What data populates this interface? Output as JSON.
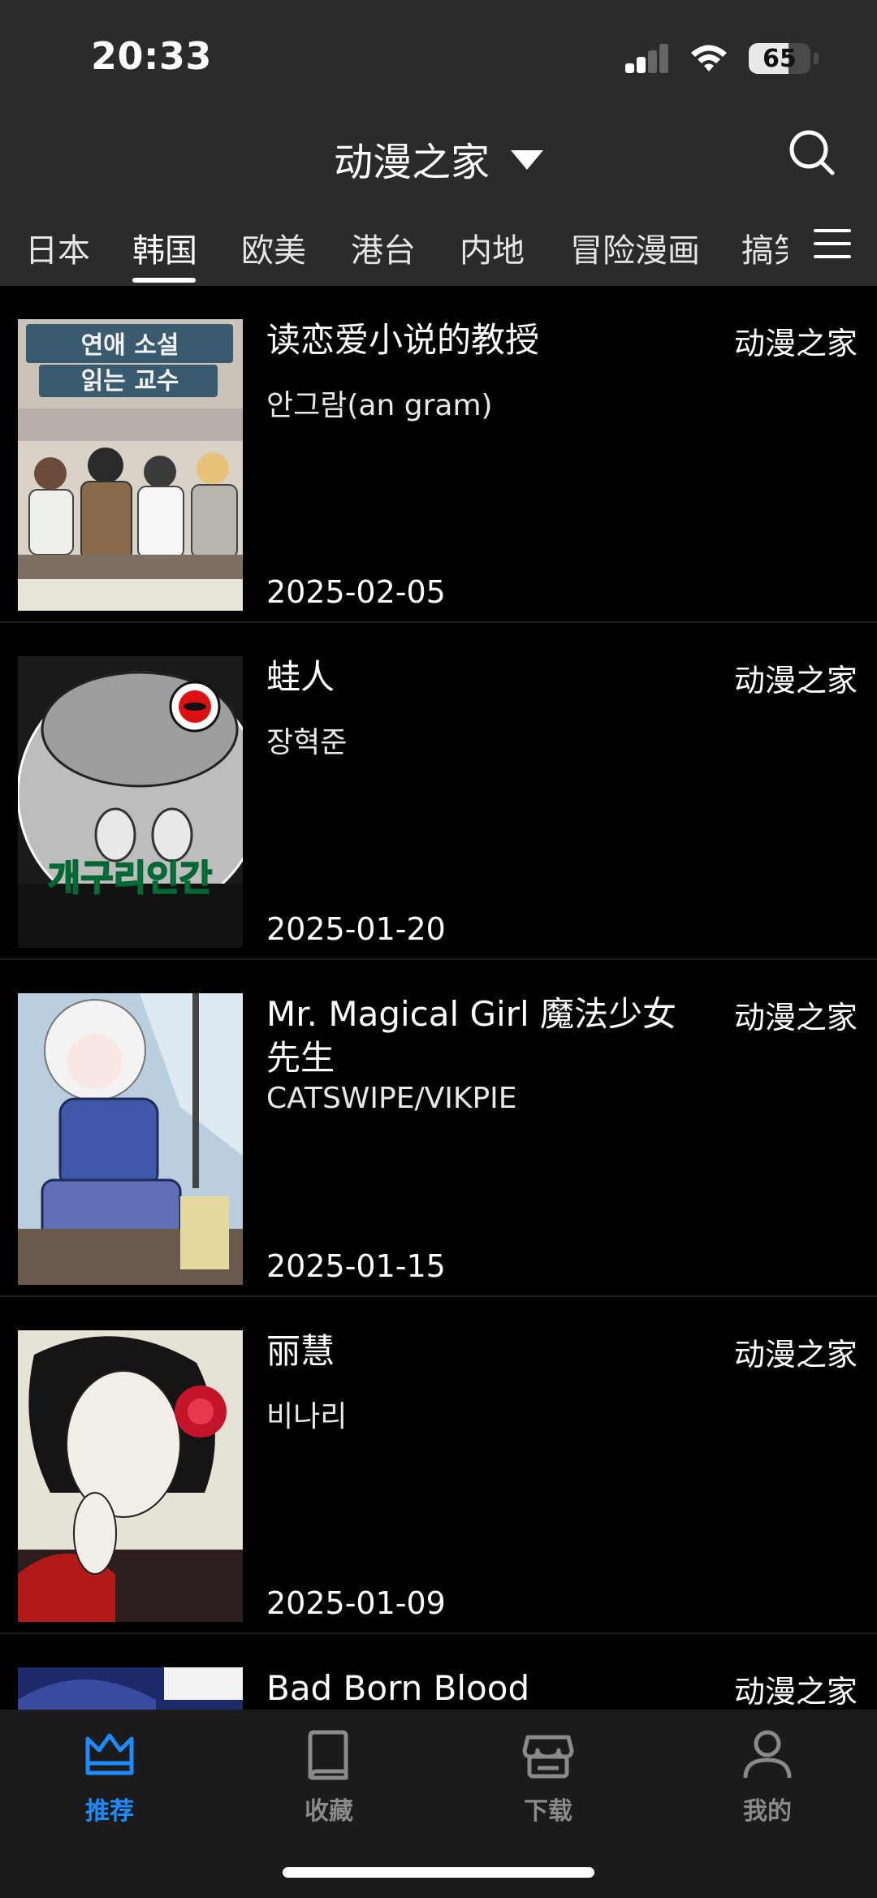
{
  "status_bar": {
    "time": "20:33",
    "battery": "65",
    "battery_level": 0.65
  },
  "header": {
    "title": "动漫之家"
  },
  "tabs": [
    {
      "label": "日本"
    },
    {
      "label": "韩国",
      "active": true
    },
    {
      "label": "欧美"
    },
    {
      "label": "港台"
    },
    {
      "label": "内地"
    },
    {
      "label": "冒险漫画"
    },
    {
      "label": "搞笑"
    }
  ],
  "comics": [
    {
      "title": "读恋爱小说的教授",
      "author": "안그람(an gram)",
      "date": "2025-02-05",
      "source": "动漫之家",
      "cover_text": "연애소설 읽는 교수"
    },
    {
      "title": "蛙人",
      "author": "장혁준",
      "date": "2025-01-20",
      "source": "动漫之家",
      "cover_text": "개구리인간"
    },
    {
      "title": "Mr. Magical Girl 魔法少女先生",
      "author": "CATSWIPE/VIKPIE",
      "date": "2025-01-15",
      "source": "动漫之家",
      "cover_text": ""
    },
    {
      "title": "丽慧",
      "author": "비나리",
      "date": "2025-01-09",
      "source": "动漫之家",
      "cover_text": ""
    },
    {
      "title": "Bad Born Blood",
      "author": "",
      "date": "",
      "source": "动漫之家",
      "cover_text": ""
    }
  ],
  "bottom_nav": [
    {
      "label": "推荐",
      "icon": "crown-icon",
      "active": true
    },
    {
      "label": "收藏",
      "icon": "book-icon"
    },
    {
      "label": "下载",
      "icon": "store-icon"
    },
    {
      "label": "我的",
      "icon": "person-icon"
    }
  ],
  "colors": {
    "accent": "#1e8bff",
    "header_bg": "#2b2b2b",
    "list_bg": "#000000",
    "nav_bg": "#1b1b1b"
  }
}
